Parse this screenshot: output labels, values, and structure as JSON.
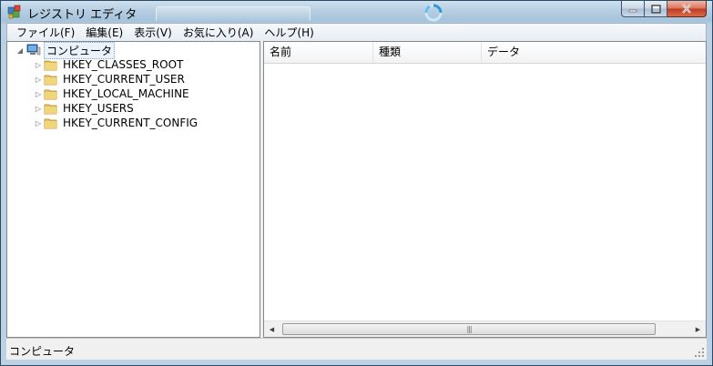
{
  "window": {
    "title": "レジストリ エディタ"
  },
  "menu": [
    {
      "label": "ファイル(F)"
    },
    {
      "label": "編集(E)"
    },
    {
      "label": "表示(V)"
    },
    {
      "label": "お気に入り(A)"
    },
    {
      "label": "ヘルプ(H)"
    }
  ],
  "tree": {
    "root": {
      "label": "コンピュータ",
      "icon": "computer-icon",
      "expanded": true
    },
    "keys": [
      {
        "label": "HKEY_CLASSES_ROOT",
        "icon": "folder-icon"
      },
      {
        "label": "HKEY_CURRENT_USER",
        "icon": "folder-icon"
      },
      {
        "label": "HKEY_LOCAL_MACHINE",
        "icon": "folder-icon"
      },
      {
        "label": "HKEY_USERS",
        "icon": "folder-icon"
      },
      {
        "label": "HKEY_CURRENT_CONFIG",
        "icon": "folder-icon"
      }
    ]
  },
  "list": {
    "columns": [
      {
        "label": "名前"
      },
      {
        "label": "種類"
      },
      {
        "label": "データ"
      }
    ]
  },
  "status": {
    "text": "コンピュータ"
  },
  "colors": {
    "selection_border": "#7da2ce",
    "folder": "#e8c75a",
    "frame": "#b7cfe3"
  }
}
